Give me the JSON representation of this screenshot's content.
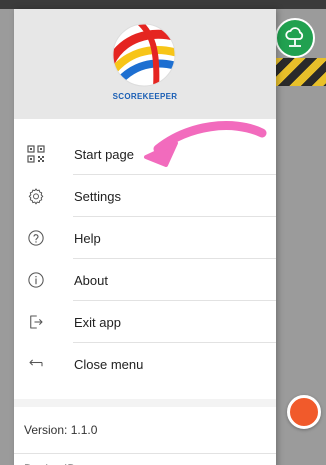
{
  "app": {
    "logo_text": "SCOREKEEPER"
  },
  "menu": {
    "items": [
      {
        "label": "Start page",
        "icon": "qr-code-icon"
      },
      {
        "label": "Settings",
        "icon": "gear-icon"
      },
      {
        "label": "Help",
        "icon": "help-circle-icon"
      },
      {
        "label": "About",
        "icon": "info-circle-icon"
      },
      {
        "label": "Exit app",
        "icon": "exit-icon"
      },
      {
        "label": "Close menu",
        "icon": "back-arrow-icon"
      }
    ]
  },
  "footer": {
    "version": "Version: 1.1.0",
    "device_id_label": "Device ID"
  },
  "colors": {
    "arrow": "#f26bbd",
    "cloud_button": "#21a150",
    "record_button": "#f15a2b",
    "logo_text": "#1b5fb5"
  }
}
